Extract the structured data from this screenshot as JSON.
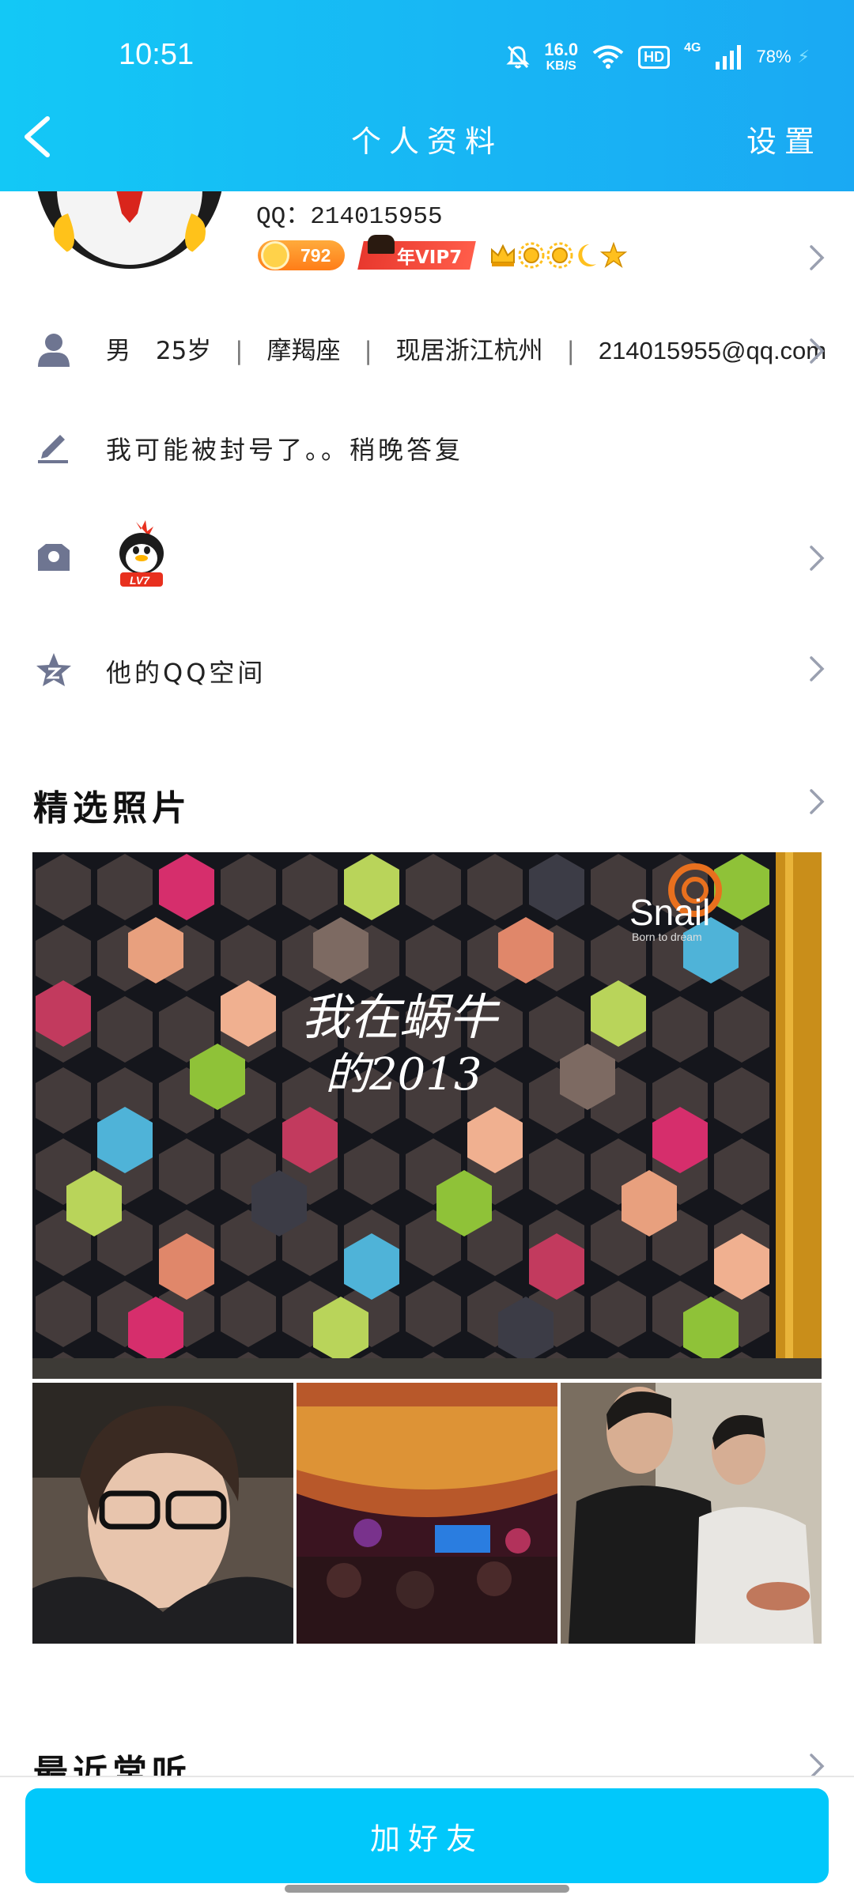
{
  "status_bar": {
    "time": "10:51",
    "net_speed_value": "16.0",
    "net_speed_unit": "KB/S",
    "hd_label": "HD",
    "network_type": "4G",
    "battery": "78%"
  },
  "nav": {
    "title": "个人资料",
    "settings": "设置"
  },
  "profile": {
    "qq_line": "QQ：214015955",
    "coin_count": "792",
    "vip_label": "年VIP7"
  },
  "info": {
    "gender": "男",
    "age": "25岁",
    "zodiac": "摩羯座",
    "location": "现居浙江杭州",
    "email": "214015955@qq.com"
  },
  "signature": "我可能被封号了。。稍晚答复",
  "level_badge": "LV7",
  "qzone_label": "他的QQ空间",
  "photos": {
    "title": "精选照片",
    "wall_text_line1": "我在蜗牛",
    "wall_text_line2": "的2013",
    "brand_name": "Snail",
    "brand_slogan": "Born to dream"
  },
  "recent": {
    "title": "最近常听"
  },
  "add_friend": "加好友",
  "colors": {
    "header_start": "#13c8f6",
    "header_end": "#1aa9f3",
    "button": "#01c8fb",
    "icon_gray": "#6e7591"
  }
}
